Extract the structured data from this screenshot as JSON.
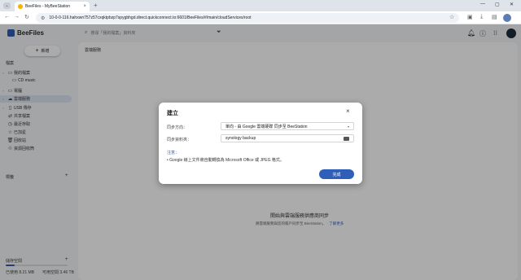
{
  "browser": {
    "tab_title": "BeeFiles - MyBeeStation",
    "tab_close": "×",
    "new_tab": "+",
    "url": "10-0-0-116.hahxwn757z57cxqktpbzp7spygbhgd.direct.quickconnect.to:6601/BeeFiles/#/main/cloudServices/root",
    "window": {
      "minimize": "—",
      "maximize": "▢",
      "close": "✕"
    }
  },
  "app": {
    "name": "BeeFiles",
    "search_placeholder": "搜尋「我的檔案」資料夾",
    "breadcrumb": "雲端服務",
    "sidebar": {
      "new_button": "新增",
      "section_label": "檔案",
      "items": [
        {
          "label": "我的檔案",
          "icon": "folder-icon",
          "caret": "›"
        },
        {
          "label": "CD music",
          "icon": "folder-icon",
          "caret": ""
        },
        {
          "label": "電腦",
          "icon": "computer-icon",
          "caret": "›"
        },
        {
          "label": "雲端服務",
          "icon": "cloud-icon",
          "caret": "›"
        },
        {
          "label": "USB 傳存",
          "icon": "usb-icon",
          "caret": "›"
        },
        {
          "label": "共享檔案",
          "icon": "share-icon",
          "caret": ""
        },
        {
          "label": "最近存取",
          "icon": "clock-icon",
          "caret": ""
        },
        {
          "label": "已加星",
          "icon": "star-icon",
          "caret": ""
        },
        {
          "label": "回收站",
          "icon": "trash-icon",
          "caret": ""
        },
        {
          "label": "資源回收筒",
          "icon": "recycle-icon",
          "caret": ""
        }
      ],
      "tags_label": "標籤",
      "storage_label": "儲存空間",
      "storage_used": "已使用 8.21 MB",
      "storage_available": "可用空間 3.46 TB",
      "storage_used_fraction": 0.14
    },
    "empty_state": {
      "title": "開始與雲端服務供應商同步",
      "subtitle": "將雲端服務與您的帳戶同步至 BeeStation。",
      "link": "了解更多"
    }
  },
  "dialog": {
    "title": "建立",
    "close": "×",
    "fields": [
      {
        "label": "同步方向：",
        "value": "單向 - 由 Google 雲端硬碟 同步至 BeeStation"
      },
      {
        "label": "同步資料夾：",
        "value": "synology backup"
      }
    ],
    "note_heading": "注意：",
    "note_item": "Google 線上文件將自動轉換為 Microsoft Office 或 JPEG 格式。",
    "done_button": "完成"
  }
}
